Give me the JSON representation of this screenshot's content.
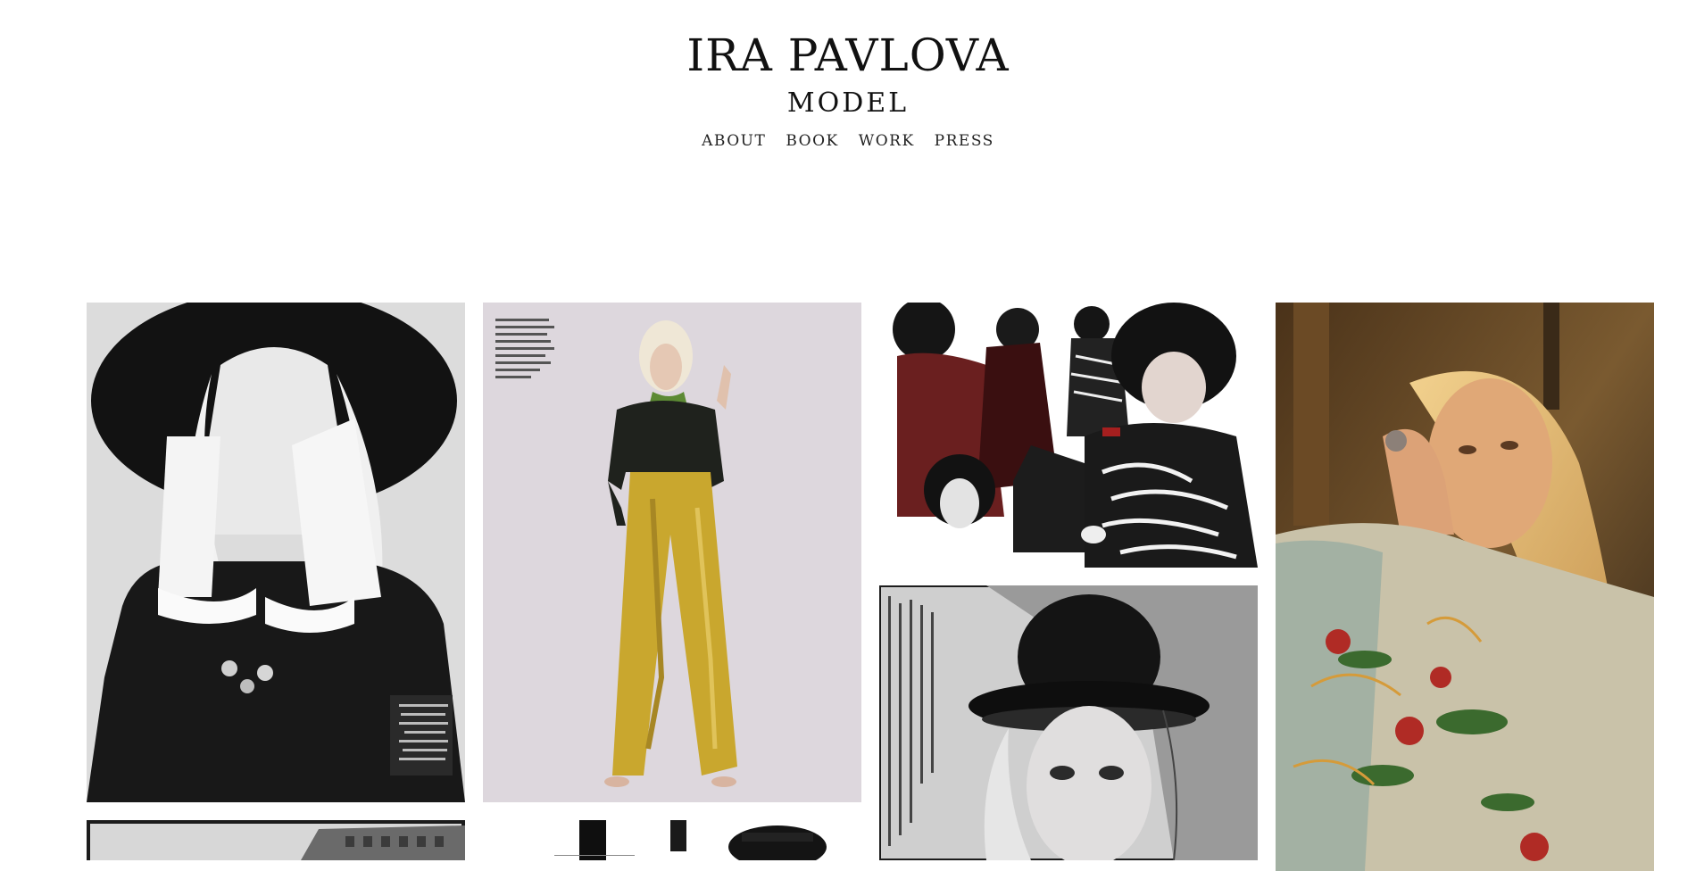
{
  "header": {
    "title": "IRA PAVLOVA",
    "subtitle": "MODEL"
  },
  "nav": {
    "items": [
      {
        "label": "ABOUT"
      },
      {
        "label": "BOOK"
      },
      {
        "label": "WORK"
      },
      {
        "label": "PRESS"
      }
    ]
  },
  "gallery": {
    "photos": [
      {
        "name": "photo-bw-wide-hat"
      },
      {
        "name": "photo-yellow-velvet-trousers"
      },
      {
        "name": "photo-collage-bob-hair"
      },
      {
        "name": "photo-bowler-hat-portrait"
      },
      {
        "name": "photo-golden-hour-embroidered-jacket"
      },
      {
        "name": "photo-city-street"
      },
      {
        "name": "photo-editorial-collage"
      }
    ]
  }
}
